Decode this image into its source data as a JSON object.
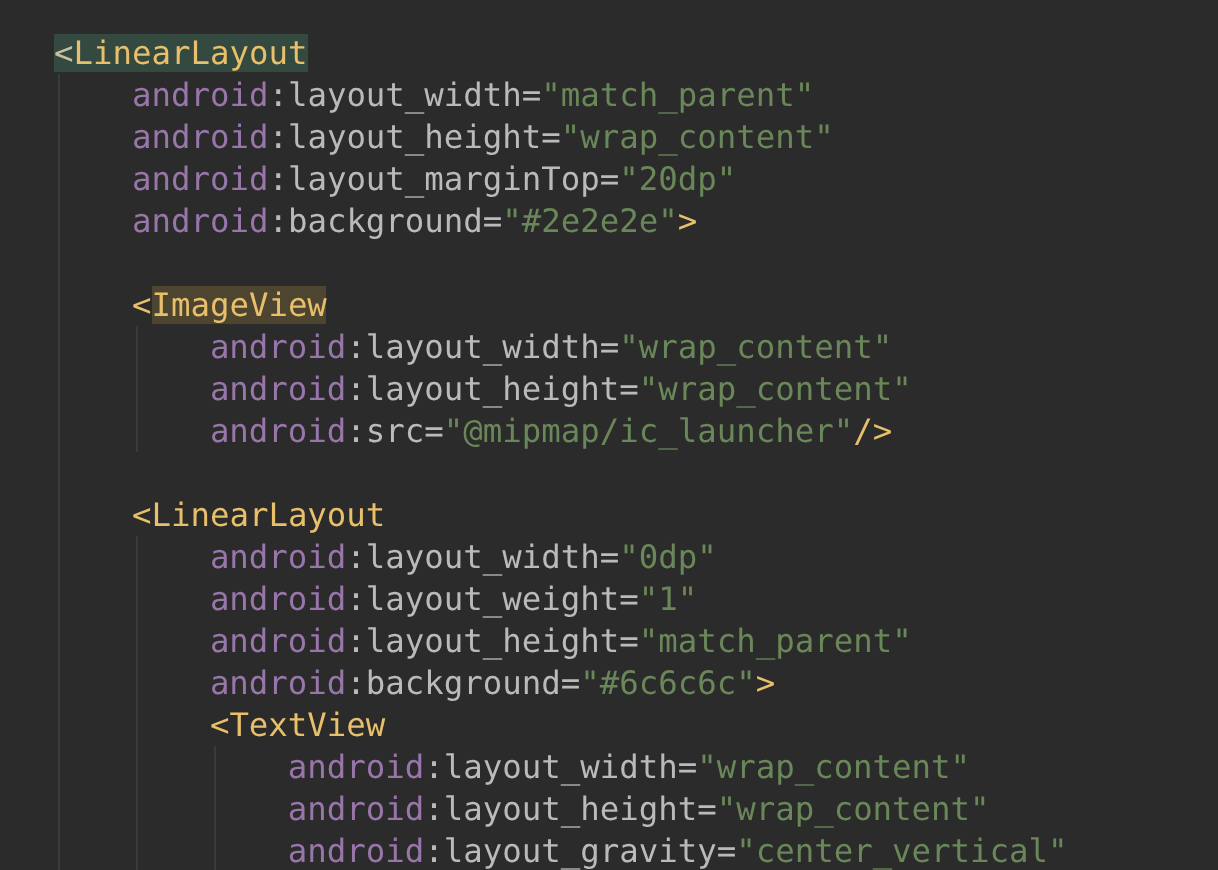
{
  "editor": {
    "root": {
      "open": "<",
      "tag": "LinearLayout",
      "caret_on": true,
      "name_highlighted": false,
      "attributes": [
        {
          "namespace": "android",
          "separator": ":",
          "name": "layout_width",
          "equals": "=",
          "value": "\"match_parent\""
        },
        {
          "namespace": "android",
          "separator": ":",
          "name": "layout_height",
          "equals": "=",
          "value": "\"wrap_content\""
        },
        {
          "namespace": "android",
          "separator": ":",
          "name": "layout_marginTop",
          "equals": "=",
          "value": "\"20dp\""
        },
        {
          "namespace": "android",
          "separator": ":",
          "name": "background",
          "equals": "=",
          "value": "\"#2e2e2e\""
        }
      ],
      "close": ">",
      "children": [
        {
          "kind": "blank_line"
        },
        {
          "kind": "element",
          "open": "<",
          "tag": "ImageView",
          "caret_on": false,
          "name_highlighted": true,
          "attributes": [
            {
              "namespace": "android",
              "separator": ":",
              "name": "layout_width",
              "equals": "=",
              "value": "\"wrap_content\""
            },
            {
              "namespace": "android",
              "separator": ":",
              "name": "layout_height",
              "equals": "=",
              "value": "\"wrap_content\""
            },
            {
              "namespace": "android",
              "separator": ":",
              "name": "src",
              "equals": "=",
              "value": "\"@mipmap/ic_launcher\""
            }
          ],
          "close": "/>"
        },
        {
          "kind": "blank_line"
        },
        {
          "kind": "element",
          "open": "<",
          "tag": "LinearLayout",
          "caret_on": false,
          "name_highlighted": false,
          "attributes": [
            {
              "namespace": "android",
              "separator": ":",
              "name": "layout_width",
              "equals": "=",
              "value": "\"0dp\""
            },
            {
              "namespace": "android",
              "separator": ":",
              "name": "layout_weight",
              "equals": "=",
              "value": "\"1\""
            },
            {
              "namespace": "android",
              "separator": ":",
              "name": "layout_height",
              "equals": "=",
              "value": "\"match_parent\""
            },
            {
              "namespace": "android",
              "separator": ":",
              "name": "background",
              "equals": "=",
              "value": "\"#6c6c6c\""
            }
          ],
          "close": ">",
          "children": [
            {
              "open": "<",
              "tag": "TextView",
              "caret_on": false,
              "name_highlighted": false,
              "attributes": [
                {
                  "namespace": "android",
                  "separator": ":",
                  "name": "layout_width",
                  "equals": "=",
                  "value": "\"wrap_content\""
                },
                {
                  "namespace": "android",
                  "separator": ":",
                  "name": "layout_height",
                  "equals": "=",
                  "value": "\"wrap_content\""
                },
                {
                  "namespace": "android",
                  "separator": ":",
                  "name": "layout_gravity",
                  "equals": "=",
                  "value": "\"center_vertical\""
                }
              ]
            }
          ]
        }
      ]
    }
  }
}
